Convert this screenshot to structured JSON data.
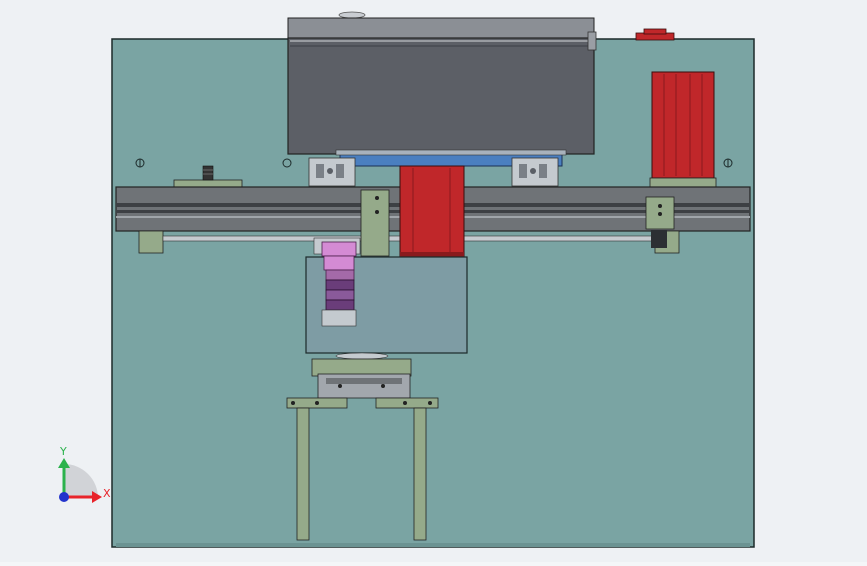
{
  "triad": {
    "x_label": "X",
    "y_label": "Y"
  },
  "colors": {
    "viewport_bg": "#eef1f4",
    "plate": "#7aa4a3",
    "gray_box": "#5c5f66",
    "rail": "#6f7377",
    "motor_red": "#c0272a",
    "bracket_green": "#95aa8a",
    "blue_strip": "#4a7fc0",
    "housing": "#7e9ca4",
    "pink_part": "#d48bd4",
    "purple_part": "#6a3d7a",
    "axis_x": "#e8232a",
    "axis_y": "#2bb24c",
    "axis_z": "#2233cc"
  }
}
